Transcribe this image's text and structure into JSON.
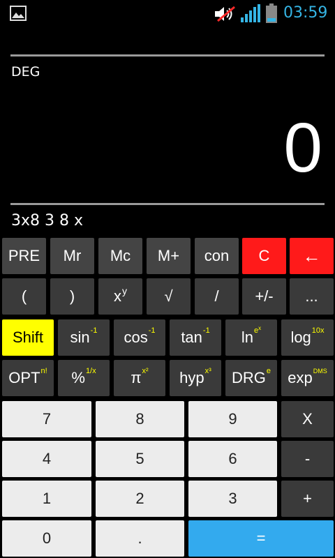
{
  "status_bar": {
    "time": "03:59",
    "icons": [
      "gallery-icon",
      "volume-muted-icon",
      "signal-icon",
      "battery-icon"
    ],
    "accent": "#35b5e5"
  },
  "display": {
    "mode": "DEG",
    "result": "0",
    "expression": "3x8 3 8 x"
  },
  "rows": {
    "r1": [
      "PRE",
      "Mr",
      "Mc",
      "M+",
      "con",
      "C",
      "←"
    ],
    "r2": [
      "(",
      ")",
      "x",
      "√",
      "/",
      "+/-",
      "..."
    ],
    "r2_sup": "y",
    "r3": {
      "shift": "Shift",
      "sin": "sin",
      "sin_sup": "-1",
      "cos": "cos",
      "cos_sup": "-1",
      "tan": "tan",
      "tan_sup": "-1",
      "ln": "ln",
      "ln_sup": "e",
      "ln_sup2": "x",
      "log": "log",
      "log_sup": "10x"
    },
    "r4": {
      "opt": "OPT",
      "opt_sup": "n!",
      "pct": "%",
      "pct_sup": "1/x",
      "pi": "π",
      "pi_sup": "x²",
      "hyp": "hyp",
      "hyp_sup": "x³",
      "drg": "DRG",
      "drg_sup": "e",
      "exp": "exp",
      "exp_sup": "DMS"
    },
    "numpad": [
      [
        "7",
        "8",
        "9",
        "X"
      ],
      [
        "4",
        "5",
        "6",
        "-"
      ],
      [
        "1",
        "2",
        "3",
        "+"
      ],
      [
        "0",
        ".",
        "="
      ]
    ]
  },
  "colors": {
    "clear": "#ff1a1a",
    "shift": "#ffff00",
    "equals": "#33aaee",
    "superscript": "#ffff00"
  }
}
